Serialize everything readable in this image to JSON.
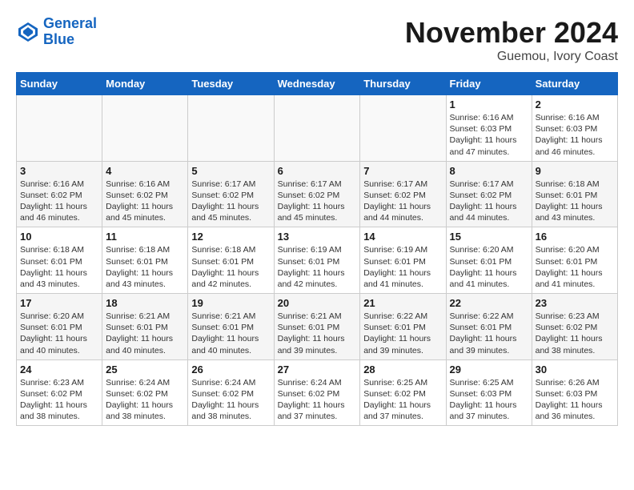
{
  "logo": {
    "line1": "General",
    "line2": "Blue"
  },
  "title": "November 2024",
  "subtitle": "Guemou, Ivory Coast",
  "days_of_week": [
    "Sunday",
    "Monday",
    "Tuesday",
    "Wednesday",
    "Thursday",
    "Friday",
    "Saturday"
  ],
  "weeks": [
    [
      {
        "day": "",
        "info": ""
      },
      {
        "day": "",
        "info": ""
      },
      {
        "day": "",
        "info": ""
      },
      {
        "day": "",
        "info": ""
      },
      {
        "day": "",
        "info": ""
      },
      {
        "day": "1",
        "info": "Sunrise: 6:16 AM\nSunset: 6:03 PM\nDaylight: 11 hours and 47 minutes."
      },
      {
        "day": "2",
        "info": "Sunrise: 6:16 AM\nSunset: 6:03 PM\nDaylight: 11 hours and 46 minutes."
      }
    ],
    [
      {
        "day": "3",
        "info": "Sunrise: 6:16 AM\nSunset: 6:02 PM\nDaylight: 11 hours and 46 minutes."
      },
      {
        "day": "4",
        "info": "Sunrise: 6:16 AM\nSunset: 6:02 PM\nDaylight: 11 hours and 45 minutes."
      },
      {
        "day": "5",
        "info": "Sunrise: 6:17 AM\nSunset: 6:02 PM\nDaylight: 11 hours and 45 minutes."
      },
      {
        "day": "6",
        "info": "Sunrise: 6:17 AM\nSunset: 6:02 PM\nDaylight: 11 hours and 45 minutes."
      },
      {
        "day": "7",
        "info": "Sunrise: 6:17 AM\nSunset: 6:02 PM\nDaylight: 11 hours and 44 minutes."
      },
      {
        "day": "8",
        "info": "Sunrise: 6:17 AM\nSunset: 6:02 PM\nDaylight: 11 hours and 44 minutes."
      },
      {
        "day": "9",
        "info": "Sunrise: 6:18 AM\nSunset: 6:01 PM\nDaylight: 11 hours and 43 minutes."
      }
    ],
    [
      {
        "day": "10",
        "info": "Sunrise: 6:18 AM\nSunset: 6:01 PM\nDaylight: 11 hours and 43 minutes."
      },
      {
        "day": "11",
        "info": "Sunrise: 6:18 AM\nSunset: 6:01 PM\nDaylight: 11 hours and 43 minutes."
      },
      {
        "day": "12",
        "info": "Sunrise: 6:18 AM\nSunset: 6:01 PM\nDaylight: 11 hours and 42 minutes."
      },
      {
        "day": "13",
        "info": "Sunrise: 6:19 AM\nSunset: 6:01 PM\nDaylight: 11 hours and 42 minutes."
      },
      {
        "day": "14",
        "info": "Sunrise: 6:19 AM\nSunset: 6:01 PM\nDaylight: 11 hours and 41 minutes."
      },
      {
        "day": "15",
        "info": "Sunrise: 6:20 AM\nSunset: 6:01 PM\nDaylight: 11 hours and 41 minutes."
      },
      {
        "day": "16",
        "info": "Sunrise: 6:20 AM\nSunset: 6:01 PM\nDaylight: 11 hours and 41 minutes."
      }
    ],
    [
      {
        "day": "17",
        "info": "Sunrise: 6:20 AM\nSunset: 6:01 PM\nDaylight: 11 hours and 40 minutes."
      },
      {
        "day": "18",
        "info": "Sunrise: 6:21 AM\nSunset: 6:01 PM\nDaylight: 11 hours and 40 minutes."
      },
      {
        "day": "19",
        "info": "Sunrise: 6:21 AM\nSunset: 6:01 PM\nDaylight: 11 hours and 40 minutes."
      },
      {
        "day": "20",
        "info": "Sunrise: 6:21 AM\nSunset: 6:01 PM\nDaylight: 11 hours and 39 minutes."
      },
      {
        "day": "21",
        "info": "Sunrise: 6:22 AM\nSunset: 6:01 PM\nDaylight: 11 hours and 39 minutes."
      },
      {
        "day": "22",
        "info": "Sunrise: 6:22 AM\nSunset: 6:01 PM\nDaylight: 11 hours and 39 minutes."
      },
      {
        "day": "23",
        "info": "Sunrise: 6:23 AM\nSunset: 6:02 PM\nDaylight: 11 hours and 38 minutes."
      }
    ],
    [
      {
        "day": "24",
        "info": "Sunrise: 6:23 AM\nSunset: 6:02 PM\nDaylight: 11 hours and 38 minutes."
      },
      {
        "day": "25",
        "info": "Sunrise: 6:24 AM\nSunset: 6:02 PM\nDaylight: 11 hours and 38 minutes."
      },
      {
        "day": "26",
        "info": "Sunrise: 6:24 AM\nSunset: 6:02 PM\nDaylight: 11 hours and 38 minutes."
      },
      {
        "day": "27",
        "info": "Sunrise: 6:24 AM\nSunset: 6:02 PM\nDaylight: 11 hours and 37 minutes."
      },
      {
        "day": "28",
        "info": "Sunrise: 6:25 AM\nSunset: 6:02 PM\nDaylight: 11 hours and 37 minutes."
      },
      {
        "day": "29",
        "info": "Sunrise: 6:25 AM\nSunset: 6:03 PM\nDaylight: 11 hours and 37 minutes."
      },
      {
        "day": "30",
        "info": "Sunrise: 6:26 AM\nSunset: 6:03 PM\nDaylight: 11 hours and 36 minutes."
      }
    ]
  ]
}
